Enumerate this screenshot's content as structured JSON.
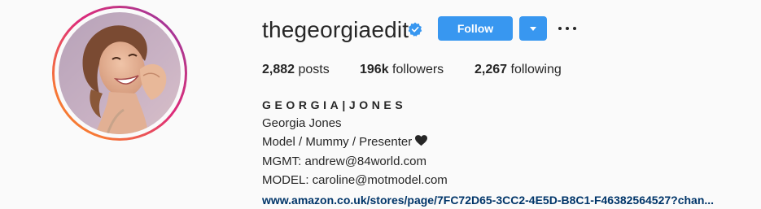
{
  "profile": {
    "username": "thegeorgiaedit",
    "verified_icon": "verified-badge-icon",
    "follow_label": "Follow",
    "dropdown_icon": "chevron-down-icon",
    "more_icon": "more-options-icon"
  },
  "stats": {
    "posts_count": "2,882",
    "posts_label": "posts",
    "followers_count": "196k",
    "followers_label": "followers",
    "following_count": "2,267",
    "following_label": "following"
  },
  "bio": {
    "full_name": "GEORGIA|JONES",
    "line1": "Georgia Jones",
    "line2": "Model / Mummy / Presenter",
    "line2_icon": "heart-icon",
    "line3": "MGMT: andrew@84world.com",
    "line4": "MODEL: caroline@motmodel.com",
    "link": "www.amazon.co.uk/stores/page/7FC72D65-3CC2-4E5D-B8C1-F46382564527?chan..."
  },
  "colors": {
    "accent": "#3897f0",
    "link": "#003569",
    "verified": "#3897f0",
    "text": "#262626",
    "background": "#fafafa"
  }
}
